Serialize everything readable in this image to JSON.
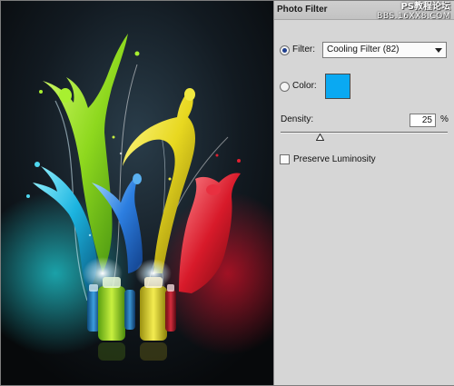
{
  "panel": {
    "title": "Photo Filter",
    "watermark": {
      "line1": "PS教程论坛",
      "line2": "BBS.16XX8.COM"
    },
    "filter": {
      "label": "Filter:",
      "selected": true,
      "value": "Cooling Filter (82)"
    },
    "color": {
      "label": "Color:",
      "selected": false,
      "swatch": "#0aa9f2"
    },
    "density": {
      "label": "Density:",
      "value": "25",
      "unit": "%",
      "level": 0.25
    },
    "preserve_luminosity": {
      "label": "Preserve Luminosity",
      "checked": false
    }
  },
  "artwork": {
    "description_icon": "paint-splash-dancers-image",
    "colors": {
      "green": "#9be020",
      "yellow": "#e8e020",
      "blue": "#2aa8f0",
      "red": "#e02030",
      "cyan": "#28c8e0"
    }
  }
}
